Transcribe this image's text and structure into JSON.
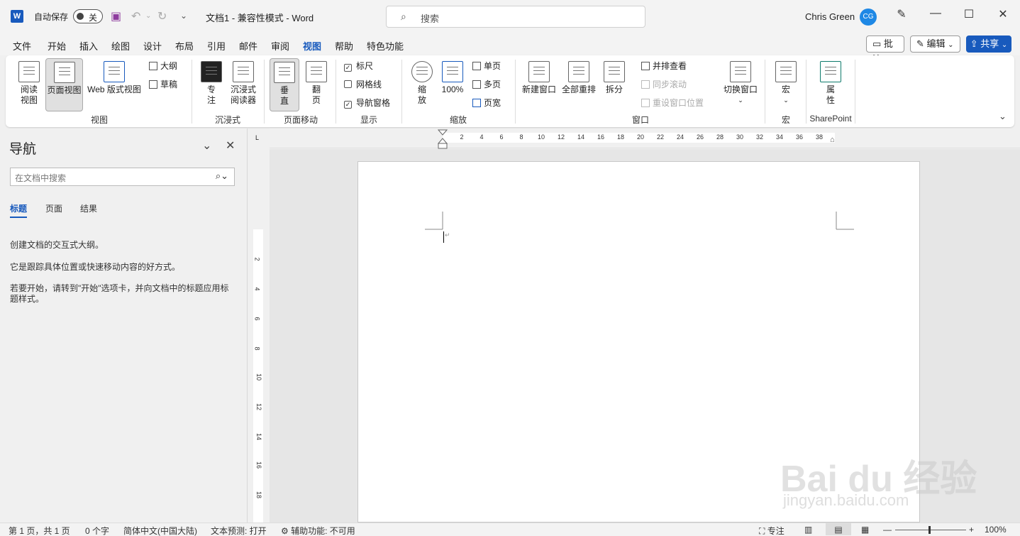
{
  "titlebar": {
    "app_badge": "W",
    "autosave_label": "自动保存",
    "autosave_state": "关",
    "doc_title": "文档1  -  兼容性模式  -  Word",
    "search_placeholder": "搜索",
    "user_name": "Chris Green",
    "user_initials": "CG"
  },
  "menu": {
    "tabs": [
      "文件",
      "开始",
      "插入",
      "绘图",
      "设计",
      "布局",
      "引用",
      "邮件",
      "审阅",
      "视图",
      "帮助",
      "特色功能"
    ],
    "active_tab": "视图",
    "comment_btn": "批注",
    "edit_btn": "编辑",
    "share_btn": "共享"
  },
  "ribbon": {
    "views": {
      "read_mode": "阅读\n视图",
      "print_layout": "页面视图",
      "web_layout": "Web 版式视图",
      "outline": "大纲",
      "draft": "草稿",
      "group": "视图"
    },
    "immersive": {
      "focus": "专\n注",
      "immersive_reader": "沉浸式\n阅读器",
      "group": "沉浸式"
    },
    "page_move": {
      "vertical": "垂\n直",
      "side_to_side": "翻\n页",
      "group": "页面移动"
    },
    "show": {
      "ruler": "标尺",
      "gridlines": "网格线",
      "nav_pane": "导航窗格",
      "group": "显示"
    },
    "zoom": {
      "zoom": "缩\n放",
      "hundred": "100%",
      "one_page": "单页",
      "multi_page": "多页",
      "page_width": "页宽",
      "group": "缩放"
    },
    "window": {
      "new_window": "新建窗口",
      "arrange_all": "全部重排",
      "split": "拆分",
      "side_by_side": "并排查看",
      "sync_scroll": "同步滚动",
      "reset_position": "重设窗口位置",
      "switch_windows": "切换窗口",
      "group": "窗口"
    },
    "macros": {
      "macros": "宏",
      "group": "宏"
    },
    "sharepoint": {
      "properties": "属\n性",
      "group": "SharePoint"
    }
  },
  "nav": {
    "title": "导航",
    "search_placeholder": "在文档中搜索",
    "tabs": [
      "标题",
      "页面",
      "结果"
    ],
    "text1": "创建文档的交互式大纲。",
    "text2": "它是跟踪具体位置或快速移动内容的好方式。",
    "text3": "若要开始，请转到\"开始\"选项卡，并向文档中的标题应用标题样式。"
  },
  "ruler": {
    "corner": "L",
    "h_ticks": [
      "2",
      "4",
      "6",
      "8",
      "10",
      "12",
      "14",
      "16",
      "18",
      "20",
      "22",
      "24",
      "26",
      "28",
      "30",
      "32",
      "34",
      "36",
      "38"
    ],
    "v_ticks": [
      "2",
      "4",
      "6",
      "8",
      "10",
      "12",
      "14",
      "16",
      "18"
    ]
  },
  "status": {
    "page": "第 1 页，共 1 页",
    "words": "0 个字",
    "language": "简体中文(中国大陆)",
    "text_prediction": "文本预测: 打开",
    "accessibility": "辅助功能: 不可用",
    "focus": "专注",
    "zoom_level": "100%"
  },
  "watermark": {
    "main": "Bai du 经验",
    "sub": "jingyan.baidu.com"
  }
}
